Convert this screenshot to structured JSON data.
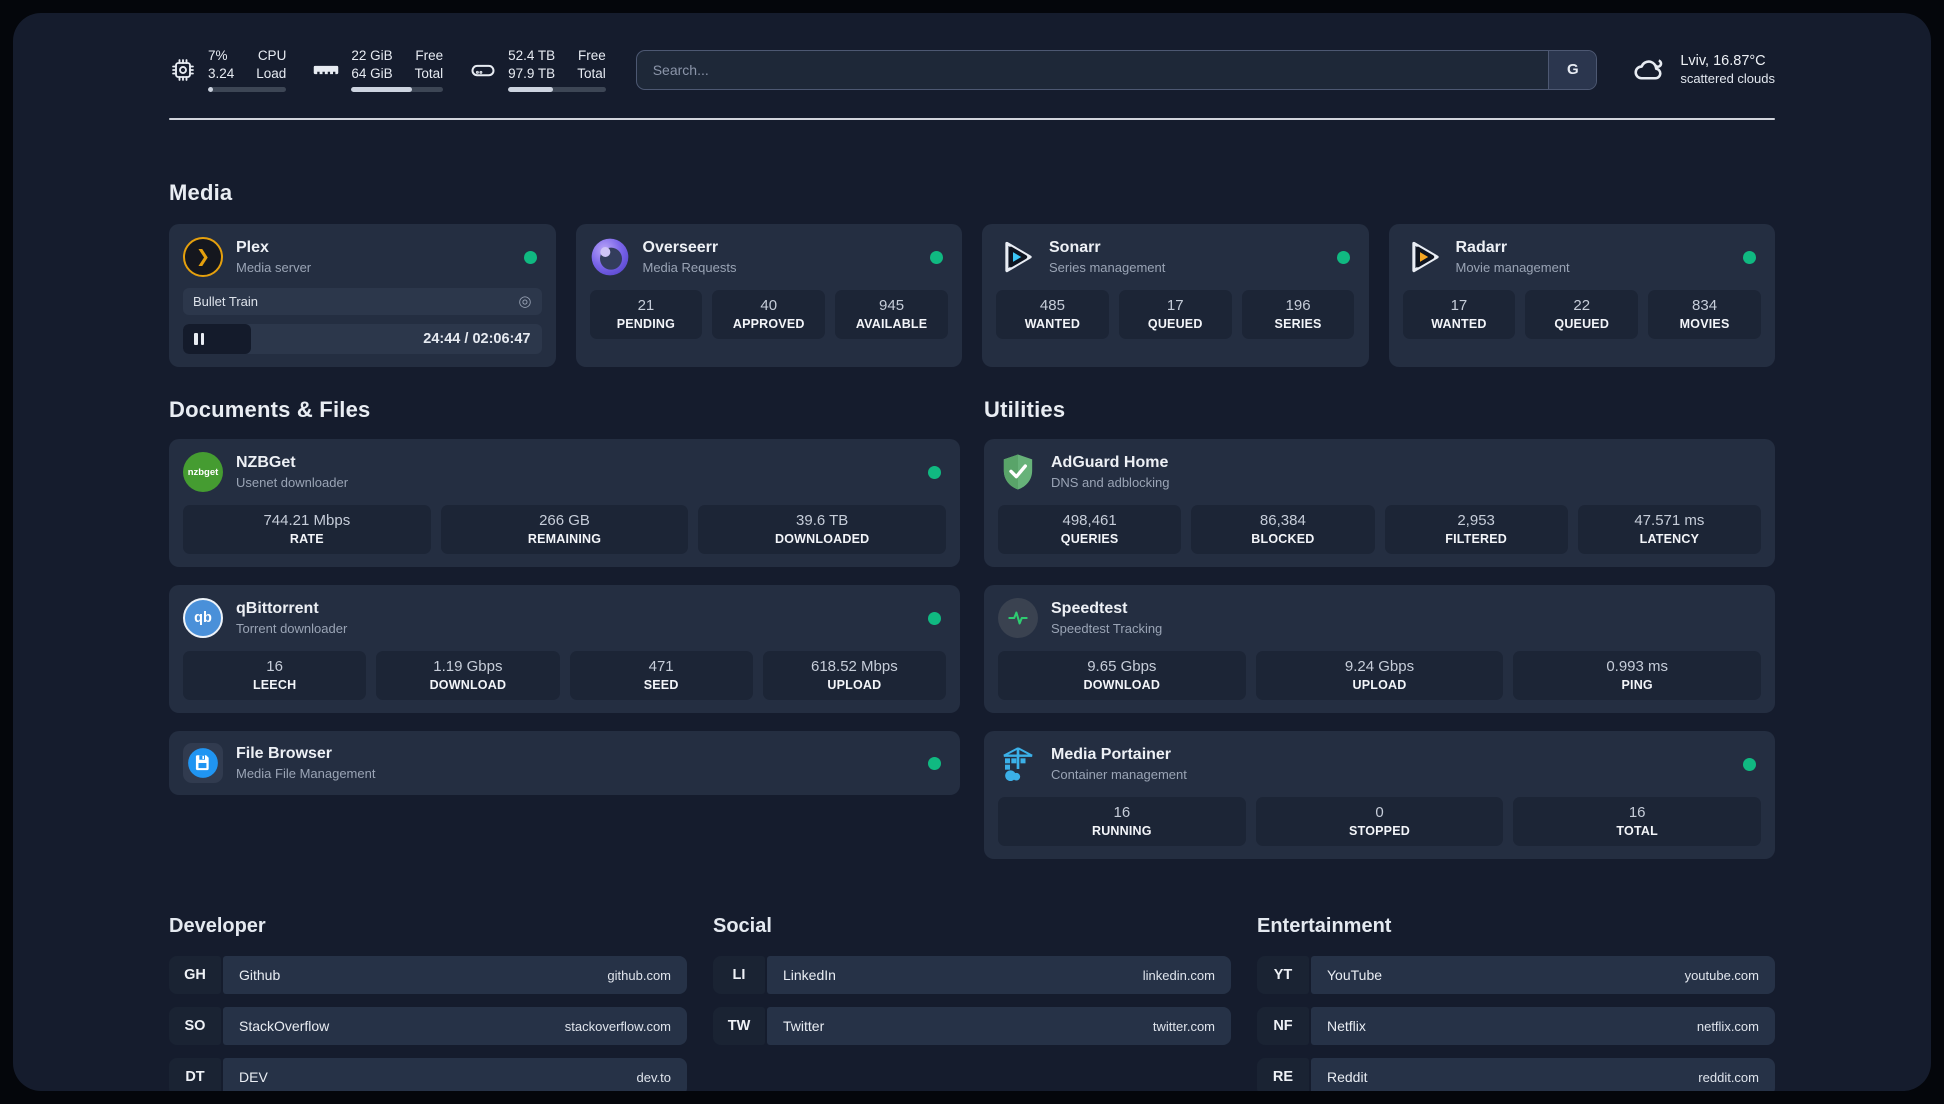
{
  "theme": {
    "status_green": "#10b981",
    "plex_orange": "#e5a00d",
    "sonarr_blue": "#3cc5f5",
    "radarr_orange": "#f5a623",
    "panel_bg": "#151c2d",
    "card_bg": "#242e41"
  },
  "topbar": {
    "cpu": {
      "line1": "7%",
      "line2": "3.24",
      "label1": "CPU",
      "label2": "Load",
      "progress_pct": 7
    },
    "ram": {
      "line1": "22 GiB",
      "line2": "64 GiB",
      "label1": "Free",
      "label2": "Total",
      "progress_pct": 66
    },
    "disk": {
      "line1": "52.4 TB",
      "line2": "97.9 TB",
      "label1": "Free",
      "label2": "Total",
      "progress_pct": 46
    },
    "search": {
      "placeholder": "Search...",
      "engine_button": "G"
    },
    "weather": {
      "headline": "Lviv, 16.87°C",
      "condition": "scattered clouds"
    }
  },
  "media": {
    "title": "Media",
    "plex": {
      "name": "Plex",
      "subtitle": "Media server",
      "now_playing": "Bullet Train",
      "time_display": "24:44 / 02:06:47",
      "progress_pct": 19
    },
    "overseerr": {
      "name": "Overseerr",
      "subtitle": "Media Requests",
      "stats": [
        {
          "value": "21",
          "label": "PENDING"
        },
        {
          "value": "40",
          "label": "APPROVED"
        },
        {
          "value": "945",
          "label": "AVAILABLE"
        }
      ]
    },
    "sonarr": {
      "name": "Sonarr",
      "subtitle": "Series management",
      "stats": [
        {
          "value": "485",
          "label": "WANTED"
        },
        {
          "value": "17",
          "label": "QUEUED"
        },
        {
          "value": "196",
          "label": "SERIES"
        }
      ]
    },
    "radarr": {
      "name": "Radarr",
      "subtitle": "Movie management",
      "stats": [
        {
          "value": "17",
          "label": "WANTED"
        },
        {
          "value": "22",
          "label": "QUEUED"
        },
        {
          "value": "834",
          "label": "MOVIES"
        }
      ]
    }
  },
  "documents": {
    "title": "Documents & Files",
    "nzbget": {
      "name": "NZBGet",
      "subtitle": "Usenet downloader",
      "icon_text": "nzbget",
      "stats": [
        {
          "value": "744.21 Mbps",
          "label": "RATE"
        },
        {
          "value": "266 GB",
          "label": "REMAINING"
        },
        {
          "value": "39.6 TB",
          "label": "DOWNLOADED"
        }
      ]
    },
    "qbittorrent": {
      "name": "qBittorrent",
      "subtitle": "Torrent downloader",
      "icon_text": "qb",
      "stats": [
        {
          "value": "16",
          "label": "LEECH"
        },
        {
          "value": "1.19 Gbps",
          "label": "DOWNLOAD"
        },
        {
          "value": "471",
          "label": "SEED"
        },
        {
          "value": "618.52 Mbps",
          "label": "UPLOAD"
        }
      ]
    },
    "filebrowser": {
      "name": "File Browser",
      "subtitle": "Media File Management"
    }
  },
  "utilities": {
    "title": "Utilities",
    "adguard": {
      "name": "AdGuard Home",
      "subtitle": "DNS and adblocking",
      "stats": [
        {
          "value": "498,461",
          "label": "QUERIES"
        },
        {
          "value": "86,384",
          "label": "BLOCKED"
        },
        {
          "value": "2,953",
          "label": "FILTERED"
        },
        {
          "value": "47.571 ms",
          "label": "LATENCY"
        }
      ]
    },
    "speedtest": {
      "name": "Speedtest",
      "subtitle": "Speedtest Tracking",
      "stats": [
        {
          "value": "9.65 Gbps",
          "label": "DOWNLOAD"
        },
        {
          "value": "9.24 Gbps",
          "label": "UPLOAD"
        },
        {
          "value": "0.993 ms",
          "label": "PING"
        }
      ]
    },
    "portainer": {
      "name": "Media Portainer",
      "subtitle": "Container management",
      "stats": [
        {
          "value": "16",
          "label": "RUNNING"
        },
        {
          "value": "0",
          "label": "STOPPED"
        },
        {
          "value": "16",
          "label": "TOTAL"
        }
      ]
    }
  },
  "links": {
    "developer": {
      "title": "Developer",
      "items": [
        {
          "abbr": "GH",
          "name": "Github",
          "url": "github.com"
        },
        {
          "abbr": "SO",
          "name": "StackOverflow",
          "url": "stackoverflow.com"
        },
        {
          "abbr": "DT",
          "name": "DEV",
          "url": "dev.to"
        }
      ]
    },
    "social": {
      "title": "Social",
      "items": [
        {
          "abbr": "LI",
          "name": "LinkedIn",
          "url": "linkedin.com"
        },
        {
          "abbr": "TW",
          "name": "Twitter",
          "url": "twitter.com"
        }
      ]
    },
    "entertainment": {
      "title": "Entertainment",
      "items": [
        {
          "abbr": "YT",
          "name": "YouTube",
          "url": "youtube.com"
        },
        {
          "abbr": "NF",
          "name": "Netflix",
          "url": "netflix.com"
        },
        {
          "abbr": "RE",
          "name": "Reddit",
          "url": "reddit.com"
        }
      ]
    }
  }
}
